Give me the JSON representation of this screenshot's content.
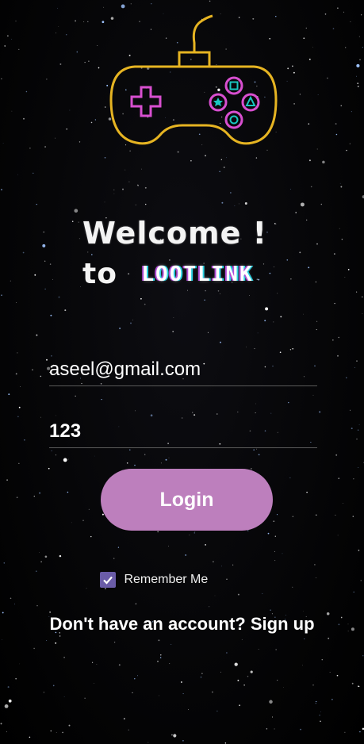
{
  "welcome": {
    "line1": "Welcome !",
    "line2_prefix": "to",
    "brand": "LOOTLINK"
  },
  "form": {
    "email_value": "aseel@gmail.com",
    "password_value": "123",
    "login_label": "Login",
    "remember_label": "Remember Me",
    "remember_checked": true,
    "signup_text": "Don't have an account? Sign up"
  },
  "logo": {
    "icon": "gamepad-icon",
    "outline_color": "#e6b422",
    "dpad_color": "#d84fd0",
    "button_color": "#19c7c0"
  },
  "colors": {
    "background": "#050505",
    "button": "#bd7fbd",
    "checkbox": "#6a5ca8"
  }
}
